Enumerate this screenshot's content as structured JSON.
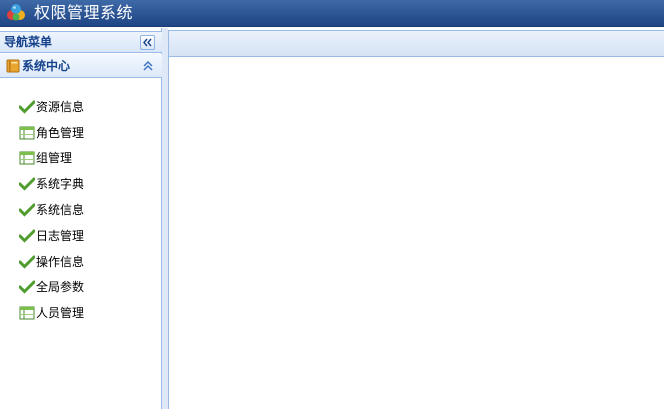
{
  "app": {
    "title": "权限管理系统",
    "logo_icon": "colored-spheres-logo-icon"
  },
  "nav": {
    "title": "导航菜单",
    "collapse_icon": "double-chevron-left-icon",
    "section": {
      "title": "系统中心",
      "icon": "book-icon",
      "toggle_icon": "double-chevron-up-icon"
    },
    "items": [
      {
        "label": "资源信息",
        "icon": "check-icon"
      },
      {
        "label": "角色管理",
        "icon": "table-icon"
      },
      {
        "label": "组管理",
        "icon": "table-icon"
      },
      {
        "label": "系统字典",
        "icon": "check-icon"
      },
      {
        "label": "系统信息",
        "icon": "check-icon"
      },
      {
        "label": "日志管理",
        "icon": "check-icon"
      },
      {
        "label": "操作信息",
        "icon": "check-icon"
      },
      {
        "label": "全局参数",
        "icon": "check-icon"
      },
      {
        "label": "人员管理",
        "icon": "table-icon"
      }
    ]
  },
  "colors": {
    "titlebar": "#2f5897",
    "panel_border": "#99bbe8",
    "header_text": "#15428b",
    "check_green": "#4f9d2f"
  }
}
